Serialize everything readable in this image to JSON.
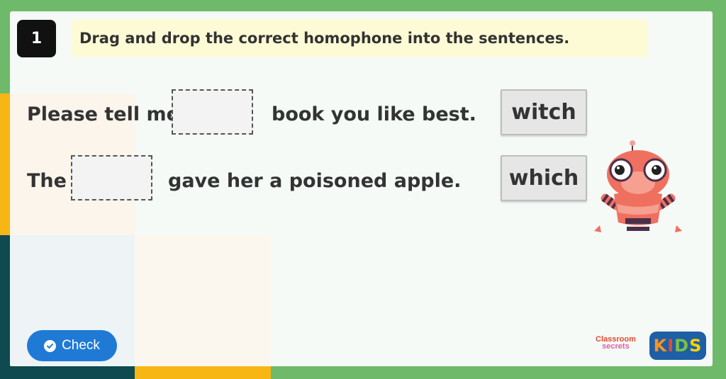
{
  "question": {
    "number": "1",
    "instruction": "Drag and drop the correct homophone into the sentences."
  },
  "sentences": [
    {
      "before": "Please tell me",
      "after": "book you like best."
    },
    {
      "before": "The",
      "after": "gave her a poisoned apple."
    }
  ],
  "word_tiles": [
    "witch",
    "which"
  ],
  "check_button": {
    "label": "Check",
    "icon": "check-circle-icon"
  },
  "brand": {
    "classroom_line1": "Classroom",
    "classroom_line2": "secrets",
    "kids_letters": [
      "K",
      "I",
      "D",
      "S"
    ],
    "kids_colors": [
      "#f7931e",
      "#e8492e",
      "#7ac143",
      "#ffd200"
    ]
  },
  "colors": {
    "background_green": "#6fb96a",
    "check_blue": "#1f7ad6",
    "instruction_bg": "#fdfbd6",
    "robot_orange": "#f07060"
  }
}
